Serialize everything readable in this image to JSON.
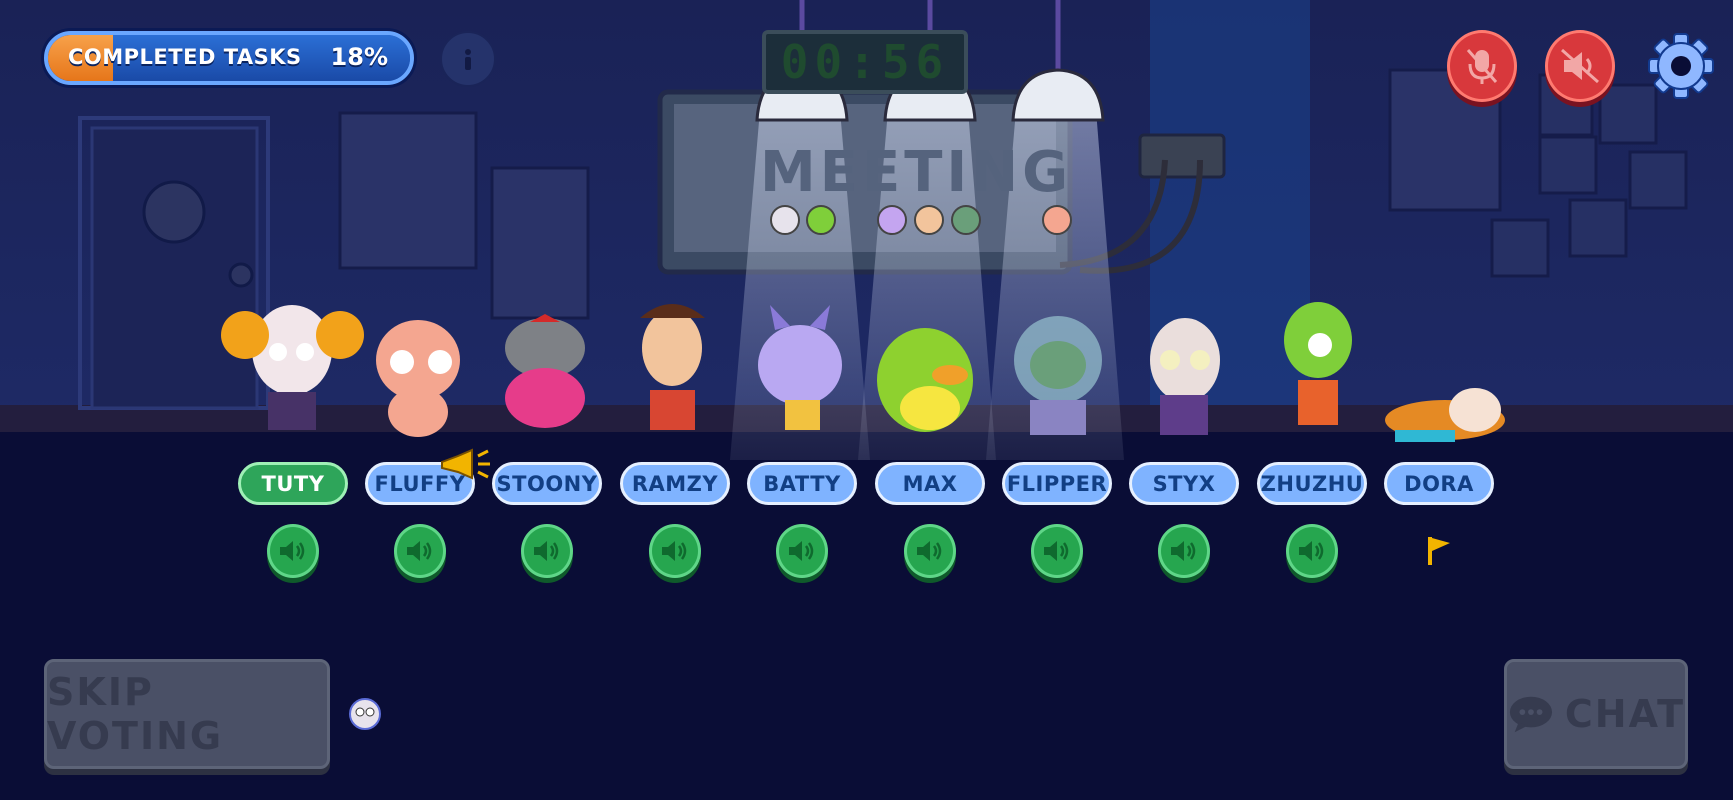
{
  "hud": {
    "progress_label": "COMPLETED TASKS",
    "progress_percent": "18%",
    "progress_value": 0.18,
    "info_icon": "info-icon",
    "mic_icon": "mic-muted-icon",
    "sound_icon": "speaker-muted-icon",
    "settings_icon": "gear-icon"
  },
  "screen": {
    "timer": "00:56",
    "title": "MEETING"
  },
  "players": [
    {
      "name": "TUTY",
      "is_self": true,
      "status": "speaker"
    },
    {
      "name": "FLUFFY",
      "is_self": false,
      "status": "speaker",
      "reported": true
    },
    {
      "name": "STOONY",
      "is_self": false,
      "status": "speaker"
    },
    {
      "name": "RAMZY",
      "is_self": false,
      "status": "speaker"
    },
    {
      "name": "BATTY",
      "is_self": false,
      "status": "speaker"
    },
    {
      "name": "MAX",
      "is_self": false,
      "status": "speaker"
    },
    {
      "name": "FLIPPER",
      "is_self": false,
      "status": "speaker"
    },
    {
      "name": "STYX",
      "is_self": false,
      "status": "speaker"
    },
    {
      "name": "ZHUZHU",
      "is_self": false,
      "status": "speaker"
    },
    {
      "name": "DORA",
      "is_self": false,
      "status": "dead-flag"
    }
  ],
  "actions": {
    "skip_voting": "SKIP VOTING",
    "chat": "CHAT"
  },
  "colors": {
    "background": "#0a0d36",
    "self_pill": "#2ea55a",
    "pill": "#7fb3ff",
    "mute_button": "#d8383c",
    "progress_fill": "#f0892b"
  }
}
